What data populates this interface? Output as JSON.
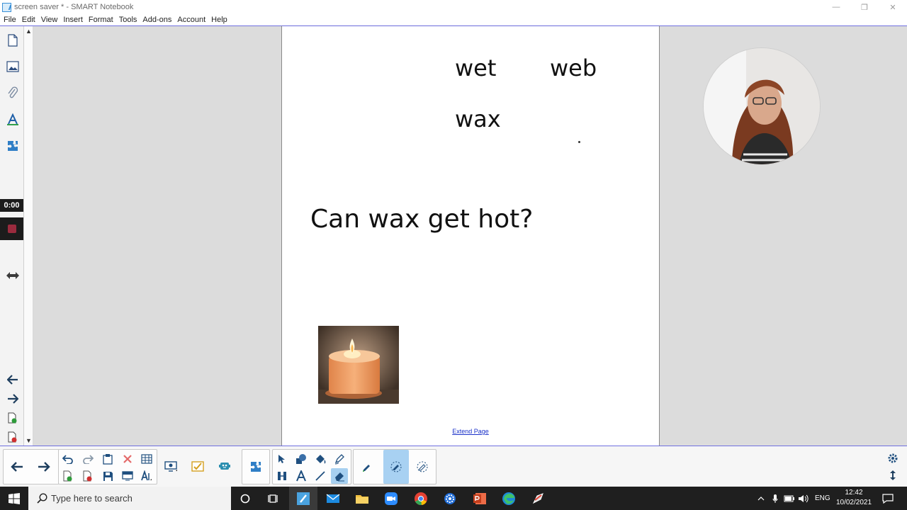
{
  "window": {
    "title": "screen saver * - SMART Notebook",
    "minimize_glyph": "—",
    "restore_glyph": "❐",
    "close_glyph": "✕"
  },
  "menu": [
    "File",
    "Edit",
    "View",
    "Insert",
    "Format",
    "Tools",
    "Add-ons",
    "Account",
    "Help"
  ],
  "sidebar": {
    "tools": [
      "page-sorter-icon",
      "gallery-icon",
      "attachments-icon",
      "properties-icon",
      "add-ons-icon"
    ],
    "timer": "0:00",
    "bottom_tools": [
      "previous-page-icon",
      "next-page-icon",
      "add-page-icon",
      "delete-page-icon"
    ]
  },
  "page": {
    "words": [
      "wet",
      "web",
      "wax"
    ],
    "question": "Can wax get hot?",
    "image": "candle-image",
    "extend_link": "Extend Page"
  },
  "toolbar": {
    "groups": [
      [
        "previous-page",
        "next-page"
      ],
      [
        "undo",
        "redo",
        "paste",
        "delete",
        "table",
        "add-page",
        "delete-page",
        "save",
        "screen-shade",
        "fonts"
      ],
      [
        "screen-capture"
      ],
      [
        "response"
      ],
      [
        "lab-activities"
      ],
      [
        "add-ons"
      ],
      [
        "select",
        "shapes",
        "fill",
        "pens",
        "measurement",
        "text",
        "lines",
        "eraser"
      ],
      [
        "magic-pen",
        "highlighter-pen",
        "creative-pen"
      ]
    ],
    "active_tool": "eraser",
    "settings_icon": "gear-icon"
  },
  "taskbar": {
    "search_placeholder": "Type here to search",
    "apps": [
      "cortana",
      "task-view",
      "smart-notebook",
      "mail",
      "file-explorer",
      "zoom",
      "chrome",
      "settings",
      "powerpoint",
      "edge",
      "smart-ink"
    ],
    "active_app": "smart-notebook",
    "language": "ENG",
    "time": "12:42",
    "date": "10/02/2021"
  },
  "colors": {
    "accent_blue": "#7070e0",
    "record_red": "#9b2b3e",
    "link_blue": "#1b32c9",
    "active_tool_bg": "#a7d0f0"
  }
}
